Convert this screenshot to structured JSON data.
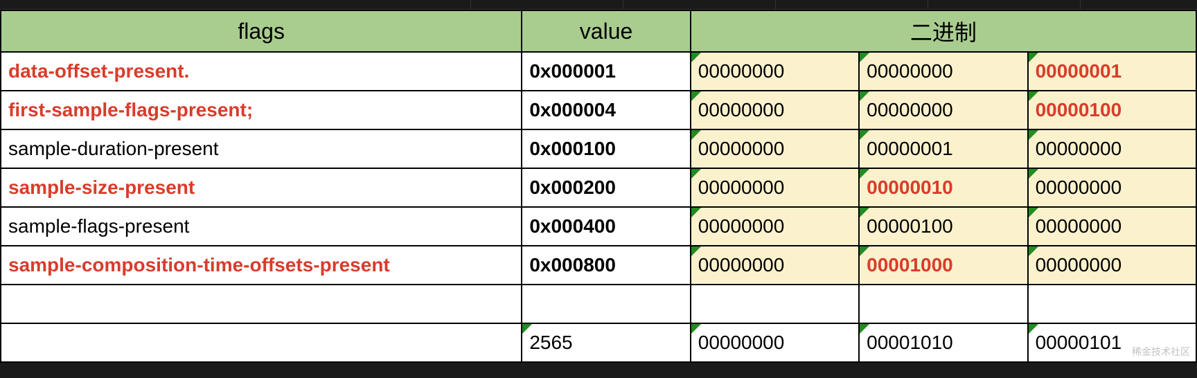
{
  "headers": {
    "flags": "flags",
    "value": "value",
    "binary": "二进制"
  },
  "rows": [
    {
      "flag": "data-offset-present.",
      "flagRed": true,
      "value": "0x000001",
      "bin": [
        "00000000",
        "00000000",
        "00000001"
      ],
      "binRed": [
        false,
        false,
        true
      ],
      "yellow": true
    },
    {
      "flag": "first-sample-flags-present;",
      "flagRed": true,
      "value": "0x000004",
      "bin": [
        "00000000",
        "00000000",
        "00000100"
      ],
      "binRed": [
        false,
        false,
        true
      ],
      "yellow": true
    },
    {
      "flag": "sample-duration-present",
      "flagRed": false,
      "value": "0x000100",
      "bin": [
        "00000000",
        "00000001",
        "00000000"
      ],
      "binRed": [
        false,
        false,
        false
      ],
      "yellow": true
    },
    {
      "flag": "sample-size-present",
      "flagRed": true,
      "value": "0x000200",
      "bin": [
        "00000000",
        "00000010",
        "00000000"
      ],
      "binRed": [
        false,
        true,
        false
      ],
      "yellow": true
    },
    {
      "flag": "sample-flags-present",
      "flagRed": false,
      "value": "0x000400",
      "bin": [
        "00000000",
        "00000100",
        "00000000"
      ],
      "binRed": [
        false,
        false,
        false
      ],
      "yellow": true
    },
    {
      "flag": "sample-composition-time-offsets-present",
      "flagRed": true,
      "value": "0x000800",
      "bin": [
        "00000000",
        "00001000",
        "00000000"
      ],
      "binRed": [
        false,
        true,
        false
      ],
      "yellow": true
    }
  ],
  "emptyRow": {
    "flag": "",
    "value": "",
    "bin": [
      "",
      "",
      ""
    ]
  },
  "sumRow": {
    "flag": "",
    "value": "2565",
    "bin": [
      "00000000",
      "00001010",
      "00000101"
    ]
  },
  "watermark": "稀金技术社区"
}
